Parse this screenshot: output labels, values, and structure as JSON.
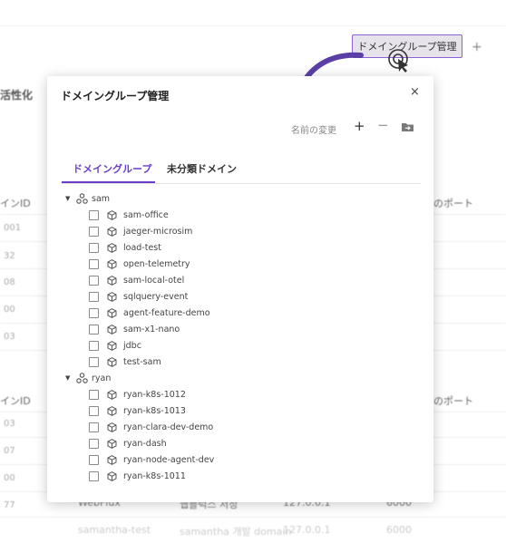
{
  "background": {
    "active_label": "活性化",
    "columns": {
      "id": "インID",
      "port": "のポート"
    },
    "section1_ids": [
      "001",
      "32",
      "08",
      "00",
      "03"
    ],
    "section2_ids": [
      "03",
      "07",
      "00",
      "77"
    ],
    "bottom_row": {
      "col1": "WebFlux",
      "col2": "웹플럭스 서정",
      "col3": "127.0.0.1",
      "col4": "6000"
    },
    "bottom_row2": {
      "col1": "samantha-test",
      "col2": "samantha 개발 domain",
      "col3": "127.0.0.1",
      "col4": "6000"
    },
    "add_symbol": "+"
  },
  "trigger_button": {
    "label": "ドメイングループ管理"
  },
  "dialog": {
    "title": "ドメイングループ管理",
    "close_symbol": "×",
    "rename_label": "名前の変更",
    "add_symbol": "+",
    "remove_symbol": "−",
    "tabs": [
      {
        "label": "ドメイングループ",
        "active": true
      },
      {
        "label": "未分類ドメイン",
        "active": false
      }
    ],
    "groups": [
      {
        "name": "sam",
        "domains": [
          "sam-office",
          "jaeger-microsim",
          "load-test",
          "open-telemetry",
          "sam-local-otel",
          "sqlquery-event",
          "agent-feature-demo",
          "sam-x1-nano",
          "jdbc",
          "test-sam"
        ]
      },
      {
        "name": "ryan",
        "domains": [
          "ryan-k8s-1012",
          "ryan-k8s-1013",
          "ryan-clara-dev-demo",
          "ryan-dash",
          "ryan-node-agent-dev",
          "ryan-k8s-1011"
        ]
      }
    ]
  },
  "colors": {
    "accent": "#6a3fc8",
    "arrow": "#5b3fa6"
  }
}
